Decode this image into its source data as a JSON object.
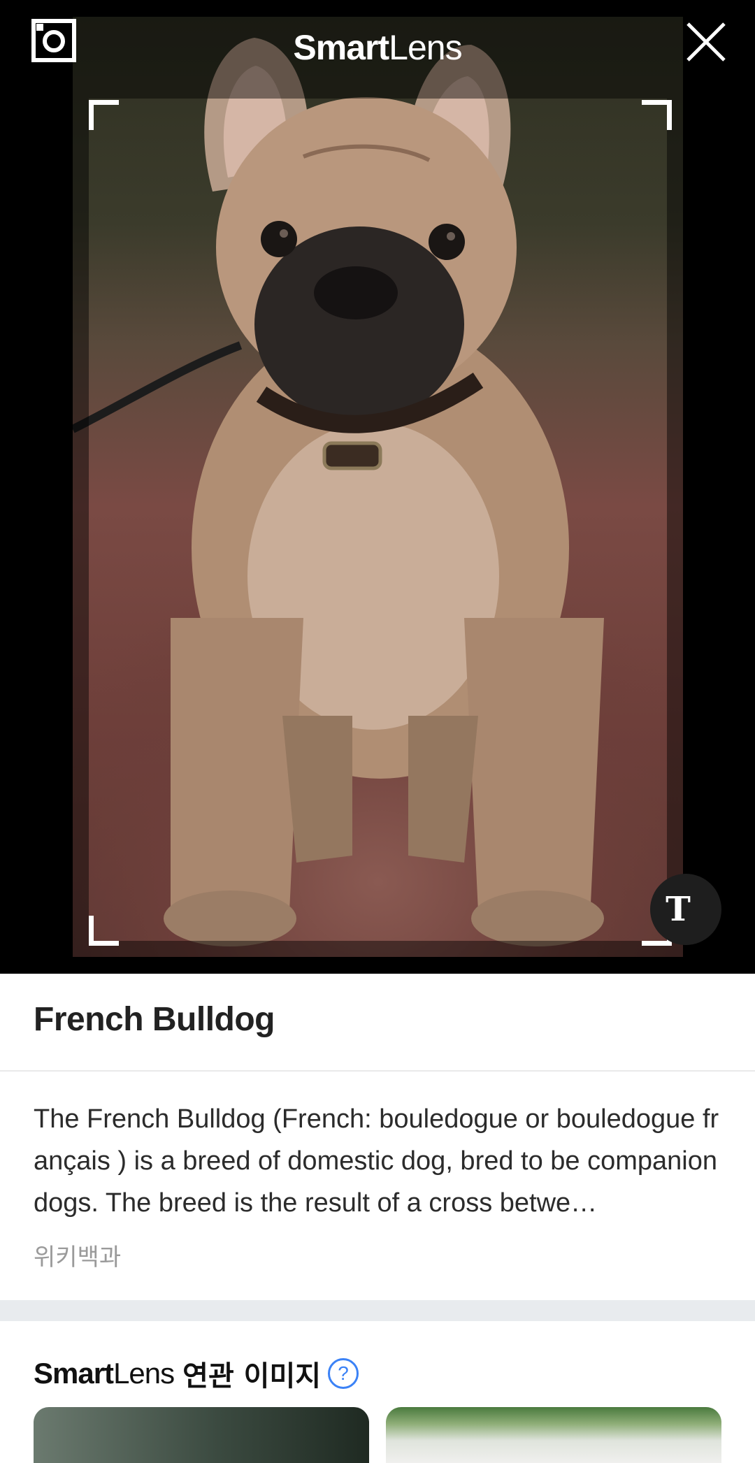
{
  "header": {
    "logo_bold": "Smart",
    "logo_regular": "Lens",
    "capture_icon": "camera-capture-icon",
    "close_icon": "close-icon"
  },
  "viewer": {
    "image_subject": "French Bulldog",
    "text_button_label": "T"
  },
  "result": {
    "title": "French Bulldog",
    "description": "The French Bulldog (French: bouledogue or bouledogue français ) is a breed of domestic dog, bred to be companion dogs. The breed is the result of a cross betwe…",
    "source": "위키백과"
  },
  "related": {
    "logo_bold": "Smart",
    "logo_regular": "Lens",
    "title": "연관 이미지",
    "help_label": "?"
  },
  "colors": {
    "viewer_background": "#000000",
    "accent_blue": "#3b82f6",
    "divider_band": "#e8ebee"
  }
}
